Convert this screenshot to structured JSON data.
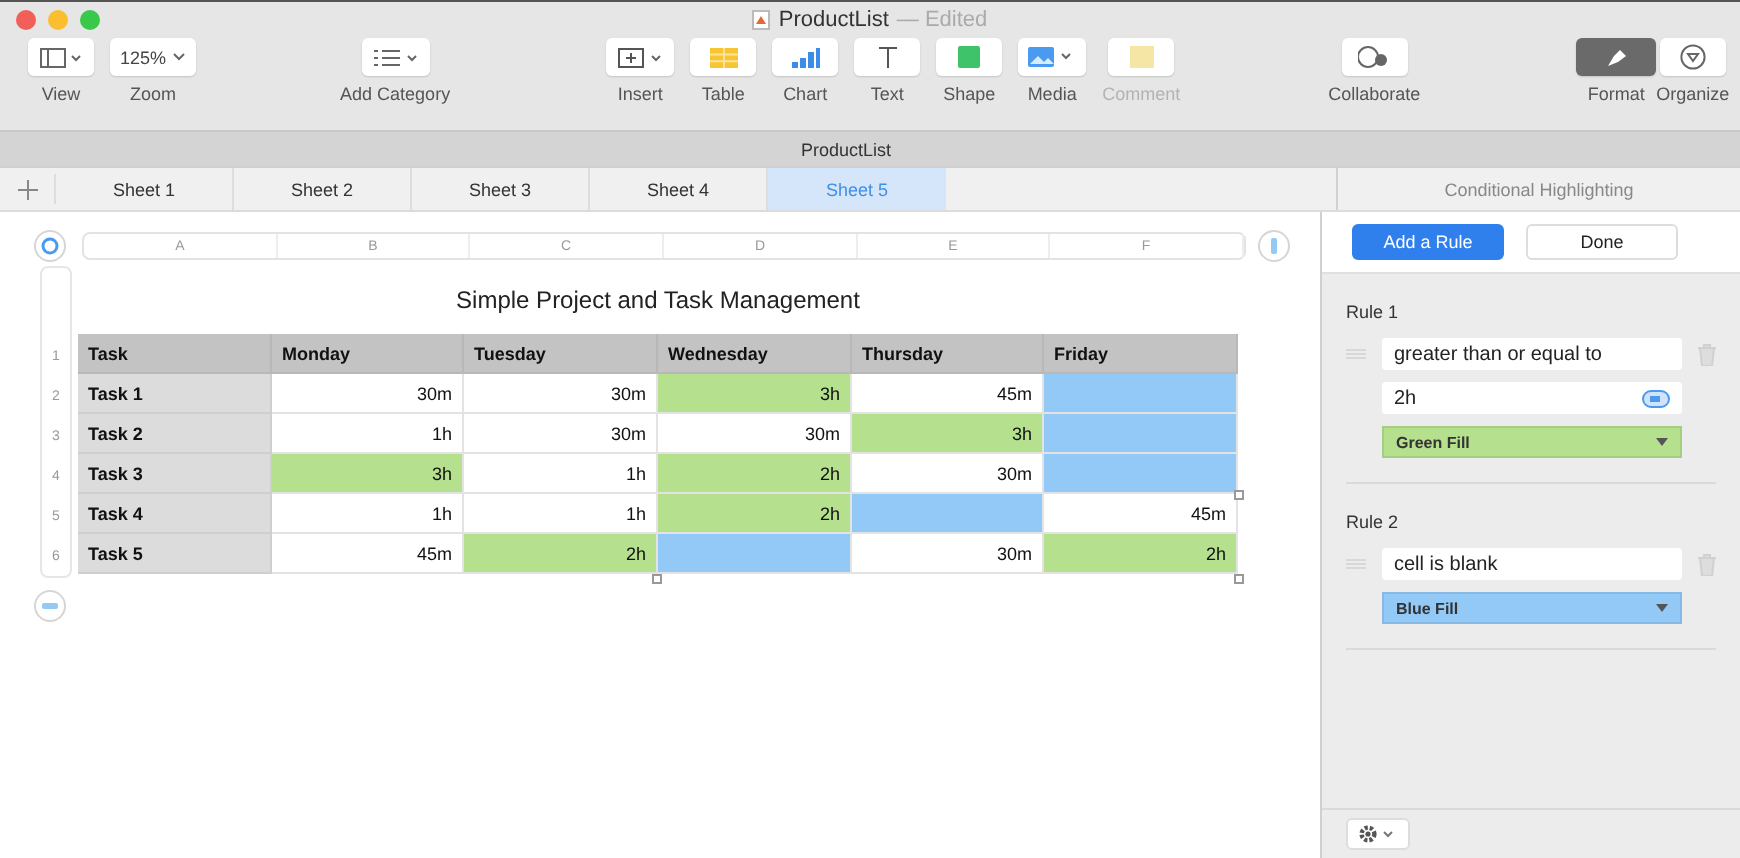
{
  "window": {
    "title": "ProductList",
    "status": "— Edited"
  },
  "toolbar": {
    "groups": [
      [
        {
          "label": "View",
          "kind": "view"
        },
        {
          "label": "Zoom",
          "kind": "zoom",
          "value": "125%"
        }
      ],
      [
        {
          "label": "Add Category",
          "kind": "category"
        }
      ],
      [
        {
          "label": "Insert",
          "kind": "insert"
        },
        {
          "label": "Table",
          "kind": "table"
        },
        {
          "label": "Chart",
          "kind": "chart"
        },
        {
          "label": "Text",
          "kind": "text"
        },
        {
          "label": "Shape",
          "kind": "shape"
        },
        {
          "label": "Media",
          "kind": "media"
        },
        {
          "label": "Comment",
          "kind": "comment",
          "disabled": true
        }
      ],
      [
        {
          "label": "Collaborate",
          "kind": "collaborate"
        }
      ],
      [
        {
          "label": "Format",
          "kind": "format",
          "selected": true
        },
        {
          "label": "Organize",
          "kind": "organize",
          "selected": false
        }
      ]
    ]
  },
  "document_bar": {
    "title": "ProductList"
  },
  "sheet_tabs": [
    {
      "label": "Sheet 1",
      "selected": false
    },
    {
      "label": "Sheet 2",
      "selected": false
    },
    {
      "label": "Sheet 3",
      "selected": false
    },
    {
      "label": "Sheet 4",
      "selected": false
    },
    {
      "label": "Sheet 5",
      "selected": true
    }
  ],
  "column_letters": [
    "A",
    "B",
    "C",
    "D",
    "E",
    "F"
  ],
  "table": {
    "title": "Simple Project and Task Management",
    "header_number": "1",
    "columns": [
      "Task",
      "Monday",
      "Tuesday",
      "Wednesday",
      "Thursday",
      "Friday"
    ],
    "rows": [
      {
        "number": "2",
        "task": "Task 1",
        "cells": [
          {
            "text": "30m"
          },
          {
            "text": "30m"
          },
          {
            "text": "3h",
            "color": "#b5e08e"
          },
          {
            "text": "45m"
          },
          {
            "color": "#92c9f7"
          }
        ]
      },
      {
        "number": "3",
        "task": "Task 2",
        "cells": [
          {
            "text": "1h"
          },
          {
            "text": "30m"
          },
          {
            "text": "30m"
          },
          {
            "text": "3h",
            "color": "#b5e08e"
          },
          {
            "color": "#92c9f7"
          }
        ]
      },
      {
        "number": "4",
        "task": "Task 3",
        "cells": [
          {
            "text": "3h",
            "color": "#b5e08e"
          },
          {
            "text": "1h"
          },
          {
            "text": "2h",
            "color": "#b5e08e"
          },
          {
            "text": "30m"
          },
          {
            "color": "#92c9f7"
          }
        ]
      },
      {
        "number": "5",
        "task": "Task 4",
        "cells": [
          {
            "text": "1h"
          },
          {
            "text": "1h"
          },
          {
            "text": "2h",
            "color": "#b5e08e"
          },
          {
            "color": "#92c9f7"
          },
          {
            "text": "45m"
          }
        ]
      },
      {
        "number": "6",
        "task": "Task 5",
        "cells": [
          {
            "text": "45m"
          },
          {
            "text": "2h",
            "color": "#b5e08e"
          },
          {
            "color": "#92c9f7"
          },
          {
            "text": "30m"
          },
          {
            "text": "2h",
            "color": "#b5e08e"
          }
        ]
      }
    ]
  },
  "sidebar": {
    "title": "Conditional Highlighting",
    "buttons": [
      {
        "label": "Add a Rule",
        "kind": "primary"
      },
      {
        "label": "Done",
        "kind": "plain"
      }
    ],
    "rules": [
      {
        "title": "Rule 1",
        "condition": "greater than or equal to",
        "value": "2h",
        "fill": {
          "label": "Green Fill",
          "color": "#b5e08e"
        }
      },
      {
        "title": "Rule 2",
        "condition": "cell is blank",
        "fill": {
          "label": "Blue Fill",
          "color": "#92c9f7"
        }
      }
    ]
  }
}
